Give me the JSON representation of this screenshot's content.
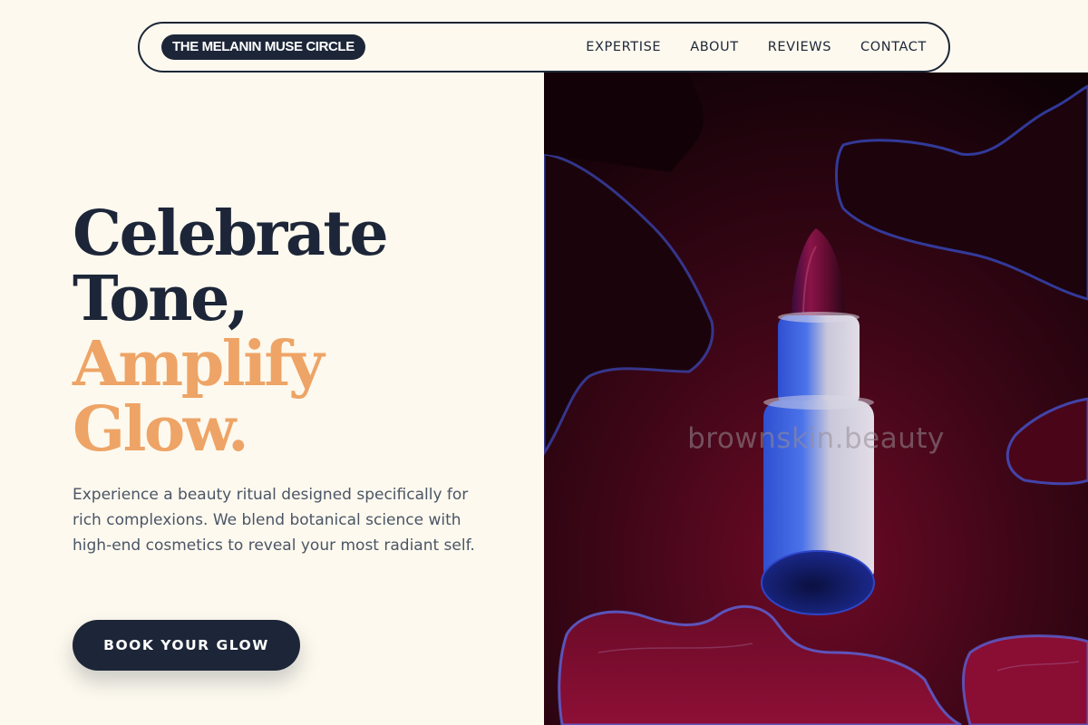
{
  "nav": {
    "brand": "THE MELANIN MUSE CIRCLE",
    "links": [
      "EXPERTISE",
      "ABOUT",
      "REVIEWS",
      "CONTACT"
    ]
  },
  "hero": {
    "headline": {
      "line1": "Celebrate",
      "line2": "Tone,",
      "line3": "Amplify",
      "line4": "Glow."
    },
    "description": "Experience a beauty ritual designed specifically for rich complexions. We blend botanical science with high-end cosmetics to reveal your most radiant self.",
    "cta_label": "BOOK YOUR GLOW",
    "image_watermark": "brownskin.beauty"
  },
  "colors": {
    "background": "#fdf9ee",
    "navy": "#1d2638",
    "accent": "#eea466",
    "body_text": "#4b5567"
  }
}
